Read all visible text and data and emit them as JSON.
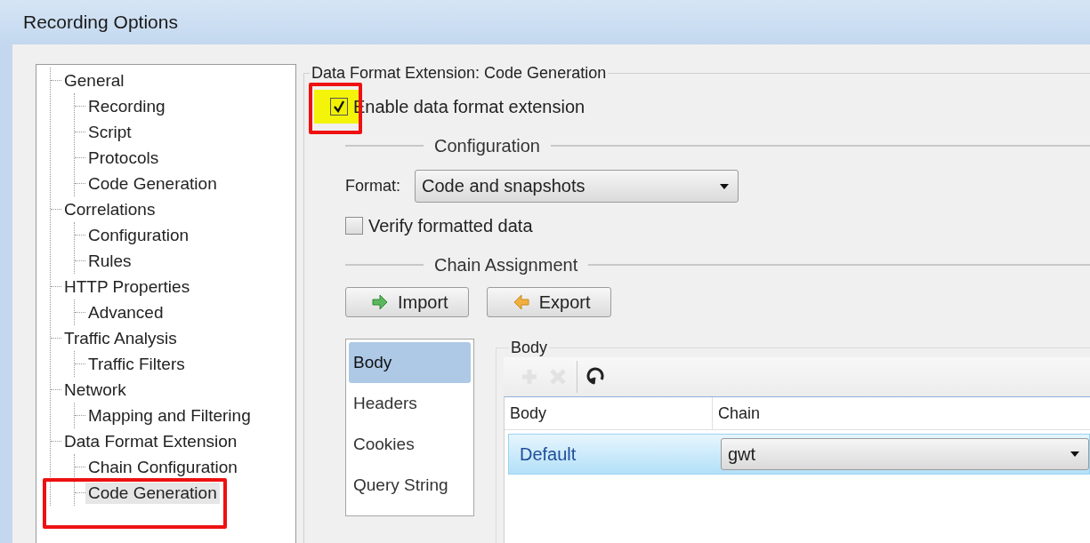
{
  "window": {
    "title": "Recording Options"
  },
  "tree": {
    "items": [
      {
        "label": "General",
        "selected": false,
        "highlighted": false,
        "children": [
          {
            "label": "Recording",
            "selected": false,
            "highlighted": false
          },
          {
            "label": "Script",
            "selected": false,
            "highlighted": false
          },
          {
            "label": "Protocols",
            "selected": false,
            "highlighted": false
          },
          {
            "label": "Code Generation",
            "selected": false,
            "highlighted": false
          }
        ]
      },
      {
        "label": "Correlations",
        "selected": false,
        "highlighted": false,
        "children": [
          {
            "label": "Configuration",
            "selected": false,
            "highlighted": false
          },
          {
            "label": "Rules",
            "selected": false,
            "highlighted": false
          }
        ]
      },
      {
        "label": "HTTP Properties",
        "selected": false,
        "highlighted": false,
        "children": [
          {
            "label": "Advanced",
            "selected": false,
            "highlighted": false
          }
        ]
      },
      {
        "label": "Traffic Analysis",
        "selected": false,
        "highlighted": false,
        "children": [
          {
            "label": "Traffic Filters",
            "selected": false,
            "highlighted": false
          }
        ]
      },
      {
        "label": "Network",
        "selected": false,
        "highlighted": false,
        "children": [
          {
            "label": "Mapping and Filtering",
            "selected": false,
            "highlighted": false
          }
        ]
      },
      {
        "label": "Data Format Extension",
        "selected": false,
        "highlighted": false,
        "children": [
          {
            "label": "Chain Configuration",
            "selected": false,
            "highlighted": false
          },
          {
            "label": "Code Generation",
            "selected": true,
            "highlighted": true
          }
        ]
      }
    ]
  },
  "panel": {
    "title": "Data Format Extension: Code Generation",
    "enable_checkbox": {
      "label": "Enable data format extension",
      "checked": true,
      "highlighted": true
    },
    "configuration": {
      "heading": "Configuration",
      "format_label": "Format:",
      "format_value": "Code and snapshots",
      "verify_checkbox": {
        "label": "Verify formatted data",
        "checked": false
      }
    },
    "chain_assignment": {
      "heading": "Chain Assignment",
      "buttons": [
        {
          "label": "Import",
          "kind": "import"
        },
        {
          "label": "Export",
          "kind": "export"
        }
      ],
      "categories": [
        {
          "label": "Body",
          "selected": true
        },
        {
          "label": "Headers",
          "selected": false
        },
        {
          "label": "Cookies",
          "selected": false
        },
        {
          "label": "Query String",
          "selected": false
        }
      ],
      "group": {
        "title": "Body",
        "toolbar": [
          {
            "kind": "add",
            "disabled": true
          },
          {
            "kind": "remove",
            "disabled": true
          },
          {
            "kind": "refresh",
            "disabled": false
          }
        ],
        "table": {
          "columns": [
            "Body",
            "Chain"
          ],
          "rows": [
            {
              "body": "Default",
              "chain": "gwt",
              "selected": true
            }
          ]
        }
      }
    }
  }
}
